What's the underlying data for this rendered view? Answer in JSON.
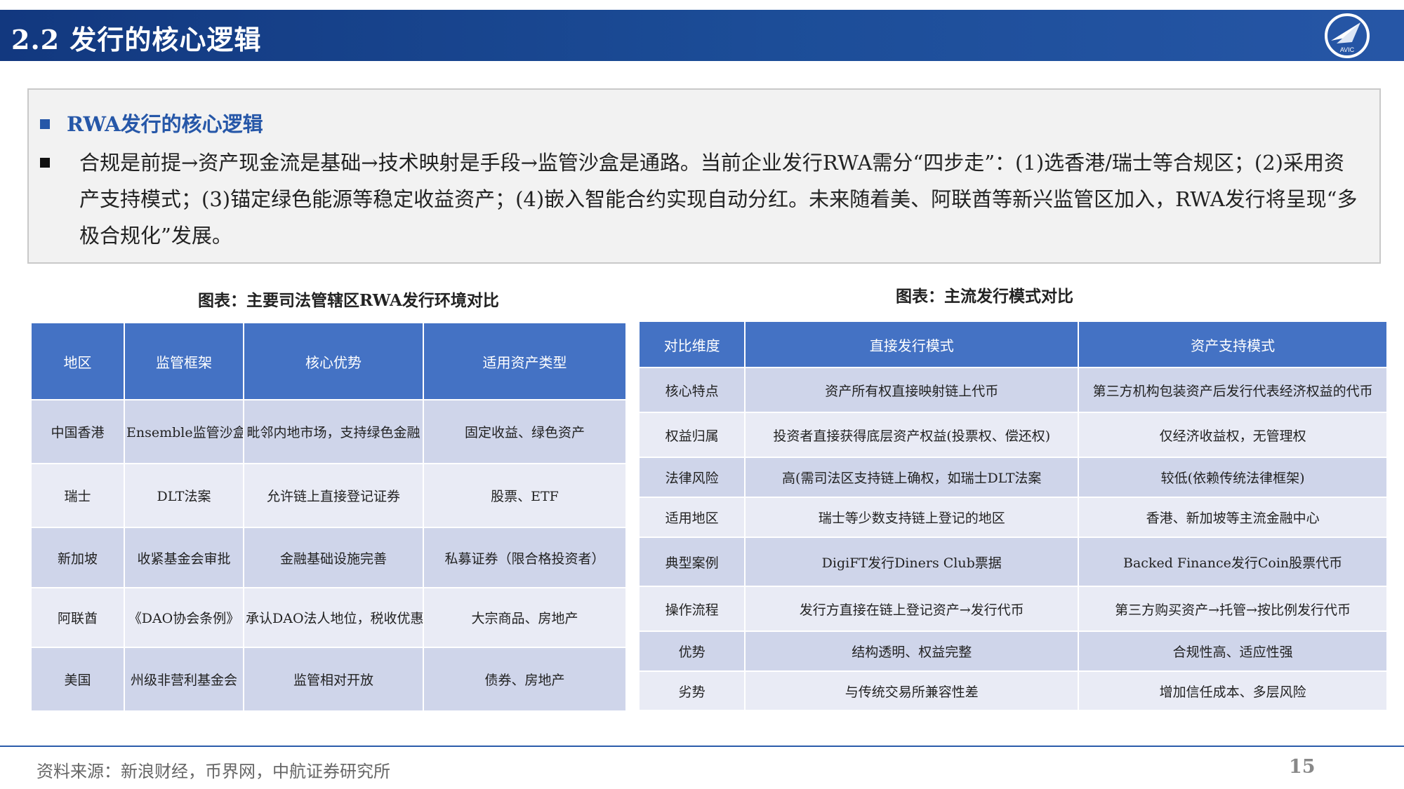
{
  "header": {
    "title": "2.2 发行的核心逻辑",
    "logo_text": "AVIC"
  },
  "summary": {
    "heading": "RWA发行的核心逻辑",
    "paragraph": "合规是前提→资产现金流是基础→技术映射是手段→监管沙盒是通路。当前企业发行RWA需分“四步走”：(1)选香港/瑞士等合规区；(2)采用资产支持模式；(3)锚定绿色能源等稳定收益资产；(4)嵌入智能合约实现自动分红。未来随着美、阿联酋等新兴监管区加入，RWA发行将呈现“多极合规化”发展。"
  },
  "left_table": {
    "caption": "图表：主要司法管辖区RWA发行环境对比",
    "headers": [
      "地区",
      "监管框架",
      "核心优势",
      "适用资产类型"
    ],
    "rows": [
      [
        "中国香港",
        "Ensemble监管沙盒",
        "毗邻内地市场，支持绿色金融",
        "固定收益、绿色资产"
      ],
      [
        "瑞士",
        "DLT法案",
        "允许链上直接登记证券",
        "股票、ETF"
      ],
      [
        "新加坡",
        "收紧基金会审批",
        "金融基础设施完善",
        "私募证券（限合格投资者）"
      ],
      [
        "阿联酋",
        "《DAO协会条例》",
        "承认DAO法人地位，税收优惠",
        "大宗商品、房地产"
      ],
      [
        "美国",
        "州级非营利基金会",
        "监管相对开放",
        "债券、房地产"
      ]
    ]
  },
  "right_table": {
    "caption": "图表：主流发行模式对比",
    "headers": [
      "对比维度",
      "直接发行模式",
      "资产支持模式"
    ],
    "rows": [
      [
        "核心特点",
        "资产所有权直接映射链上代币",
        "第三方机构包装资产后发行代表经济权益的代币"
      ],
      [
        "权益归属",
        "投资者直接获得底层资产权益(投票权、偿还权)",
        "仅经济收益权，无管理权"
      ],
      [
        "法律风险",
        "高(需司法区支持链上确权，如瑞士DLT法案",
        "较低(依赖传统法律框架)"
      ],
      [
        "适用地区",
        "瑞士等少数支持链上登记的地区",
        "香港、新加坡等主流金融中心"
      ],
      [
        "典型案例",
        "DigiFT发行Diners Club票据",
        "Backed Finance发行Coin股票代币"
      ],
      [
        "操作流程",
        "发行方直接在链上登记资产→发行代币",
        "第三方购买资产→托管→按比例发行代币"
      ],
      [
        "优势",
        "结构透明、权益完整",
        "合规性高、适应性强"
      ],
      [
        "劣势",
        "与传统交易所兼容性差",
        "增加信任成本、多层风险"
      ]
    ]
  },
  "footer": {
    "source": "资料来源：新浪财经，币界网，中航证券研究所",
    "page_number": "15"
  },
  "colors": {
    "header_blue": "#1c4d98",
    "table_header": "#4472c4",
    "row_dark": "#cfd5ea",
    "row_light": "#e9ebf5"
  }
}
